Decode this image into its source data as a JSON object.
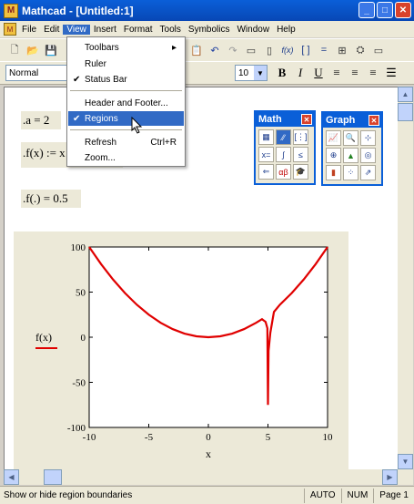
{
  "window": {
    "title": "Mathcad - [Untitled:1]"
  },
  "menubar": [
    "File",
    "Edit",
    "View",
    "Insert",
    "Format",
    "Tools",
    "Symbolics",
    "Window",
    "Help"
  ],
  "toolbar2": {
    "style_value": "Normal",
    "font_size": "10"
  },
  "view_menu": {
    "items": [
      {
        "label": "Toolbars",
        "submenu": true
      },
      {
        "label": "Ruler"
      },
      {
        "label": "Status Bar",
        "checked": true
      },
      {
        "label": "Header and Footer..."
      },
      {
        "label": "Regions",
        "checked": true,
        "highlighted": true
      },
      {
        "label": "Refresh",
        "shortcut": "Ctrl+R"
      },
      {
        "label": "Zoom..."
      }
    ]
  },
  "worksheet": {
    "def_a": ".a = 2",
    "def_f": ".f(x) := x",
    "eval_f": ".f(.) = 0.5",
    "plot_ylabel": "f(x)",
    "plot_xlabel": "x"
  },
  "palettes": {
    "math": {
      "title": "Math"
    },
    "graph": {
      "title": "Graph"
    }
  },
  "statusbar": {
    "text": "Show or hide region boundaries",
    "mode": "AUTO",
    "num": "NUM",
    "page": "Page 1"
  },
  "chart_data": {
    "type": "line",
    "xlim": [
      -10,
      10
    ],
    "ylim": [
      -100,
      100
    ],
    "xticks": [
      -10,
      -5,
      0,
      5,
      10
    ],
    "yticks": [
      100,
      50,
      0,
      -50,
      -100
    ],
    "xlabel": "x",
    "ylabel": "f(x)",
    "grid": false,
    "series": [
      {
        "color": "#e00000",
        "x": [
          -10,
          -9,
          -8,
          -7,
          -6,
          -5,
          -4,
          -3,
          -2,
          -1,
          0,
          1,
          2,
          3,
          4,
          4.5,
          4.8,
          4.95,
          5.0,
          5.05,
          5.2,
          5.5,
          6,
          7,
          8,
          9,
          10
        ],
        "y": [
          100,
          81,
          64,
          49,
          36,
          25,
          16,
          9,
          4,
          1,
          0,
          1,
          4,
          9,
          16,
          20,
          17,
          10,
          -75,
          -15,
          5,
          28,
          36,
          49,
          64,
          81,
          100
        ]
      }
    ]
  }
}
